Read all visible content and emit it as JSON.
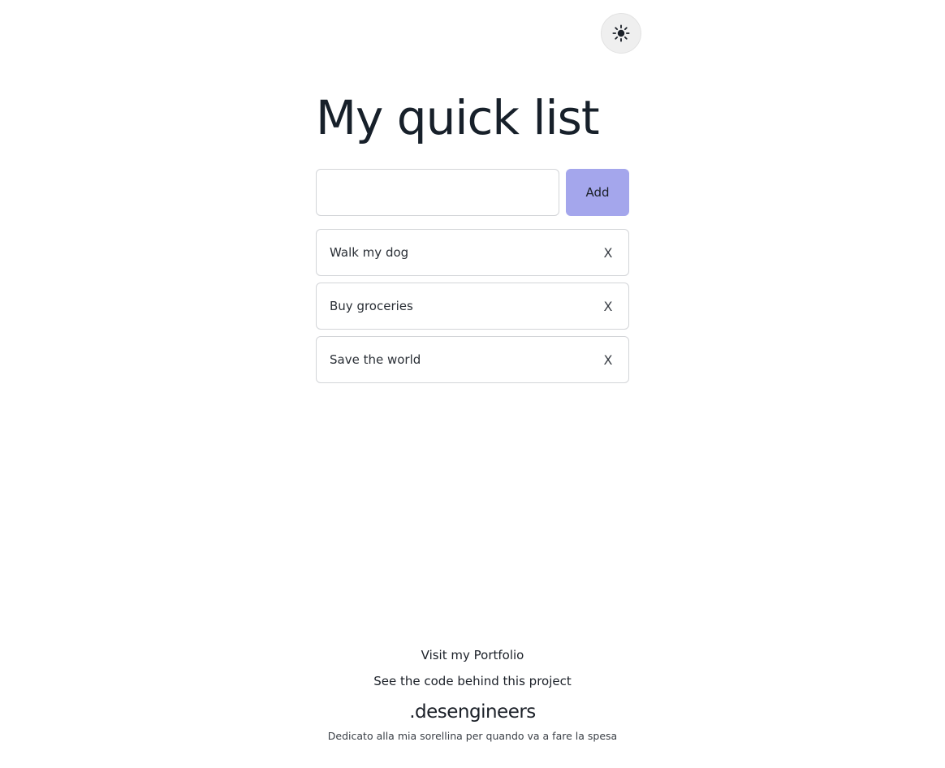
{
  "header": {
    "theme_toggle_icon": "sun-icon"
  },
  "main": {
    "title": "My quick list",
    "input": {
      "value": "",
      "placeholder": ""
    },
    "add_label": "Add",
    "tasks": [
      {
        "text": "Walk my dog",
        "remove_label": "X"
      },
      {
        "text": "Buy groceries",
        "remove_label": "X"
      },
      {
        "text": "Save the world",
        "remove_label": "X"
      }
    ]
  },
  "footer": {
    "portfolio_link": "Visit my Portfolio",
    "code_link": "See the code behind this project",
    "brand": ".desengineers",
    "dedication": "Dedicato alla mia sorellina per quando va a fare la spesa"
  },
  "colors": {
    "accent": "#a4a6ec",
    "text": "#1b2028",
    "border": "#d3d5d8",
    "toggle_bg": "#efefef"
  }
}
